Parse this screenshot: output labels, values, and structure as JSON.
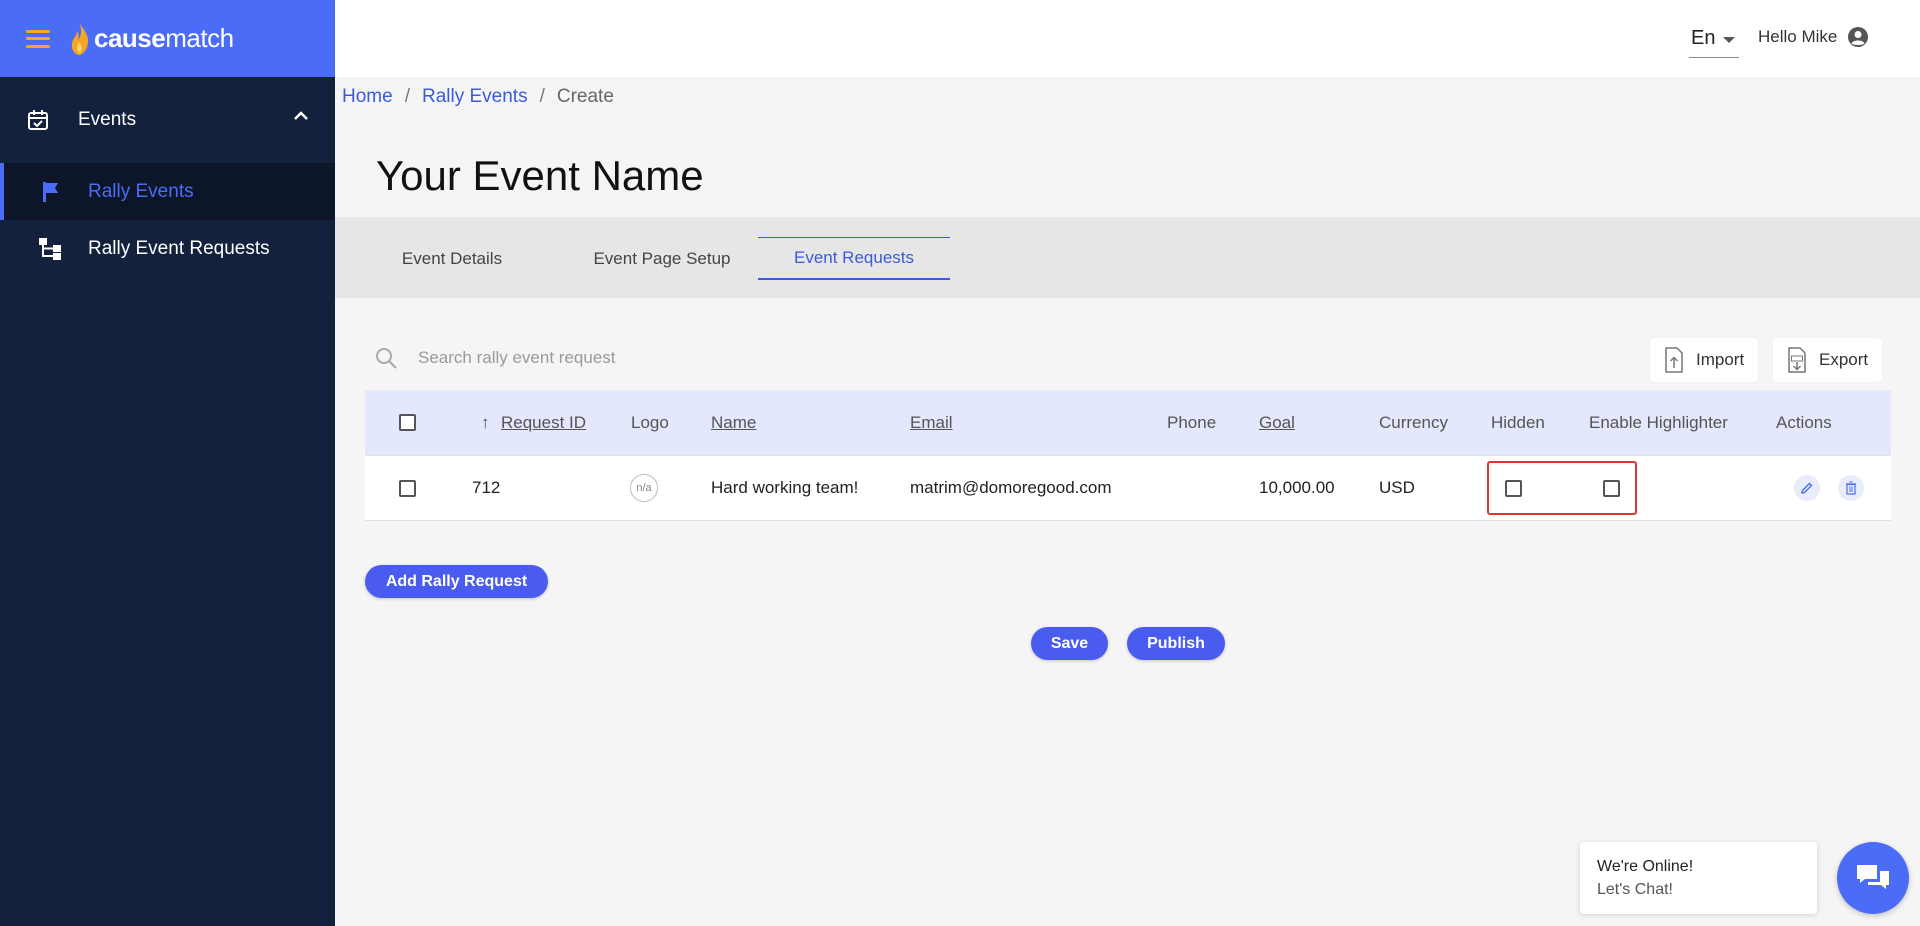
{
  "brand": {
    "name_bold": "cause",
    "name_light": "match"
  },
  "sidebar": {
    "group": {
      "label": "Events",
      "icon": "calendar-check-icon",
      "expanded": true
    },
    "items": [
      {
        "label": "Rally Events",
        "icon": "flag-icon",
        "active": true
      },
      {
        "label": "Rally Event Requests",
        "icon": "hierarchy-icon",
        "active": false
      }
    ]
  },
  "topbar": {
    "language": "En",
    "greeting": "Hello Mike"
  },
  "breadcrumb": {
    "home": "Home",
    "section": "Rally Events",
    "current": "Create",
    "separator": "/"
  },
  "page": {
    "title": "Your Event Name"
  },
  "tabs": [
    {
      "label": "Event Details",
      "active": false
    },
    {
      "label": "Event Page Setup",
      "active": false
    },
    {
      "label": "Event Requests",
      "active": true
    }
  ],
  "search": {
    "placeholder": "Search rally event request",
    "value": ""
  },
  "toolbar": {
    "import_label": "Import",
    "export_label": "Export"
  },
  "table": {
    "columns": {
      "request_id": "Request ID",
      "logo": "Logo",
      "name": "Name",
      "email": "Email",
      "phone": "Phone",
      "goal": "Goal",
      "currency": "Currency",
      "hidden": "Hidden",
      "enable_highlighter": "Enable Highlighter",
      "actions": "Actions"
    },
    "sort_indicator": "↑",
    "rows": [
      {
        "request_id": "712",
        "logo": "n/a",
        "name": "Hard working team!",
        "email": "matrim@domoregood.com",
        "phone": "",
        "goal": "10,000.00",
        "currency": "USD",
        "hidden": false,
        "enable_highlighter": false
      }
    ]
  },
  "buttons": {
    "add_request": "Add Rally Request",
    "save": "Save",
    "publish": "Publish"
  },
  "chat": {
    "line1": "We're Online!",
    "line2": "Let's Chat!"
  },
  "colors": {
    "accent": "#4a6cf7",
    "sidebar_bg": "#14213d",
    "header_row_bg": "#e3e8fd",
    "logo_flame": "#f5a623",
    "highlight_border": "#e03535"
  }
}
